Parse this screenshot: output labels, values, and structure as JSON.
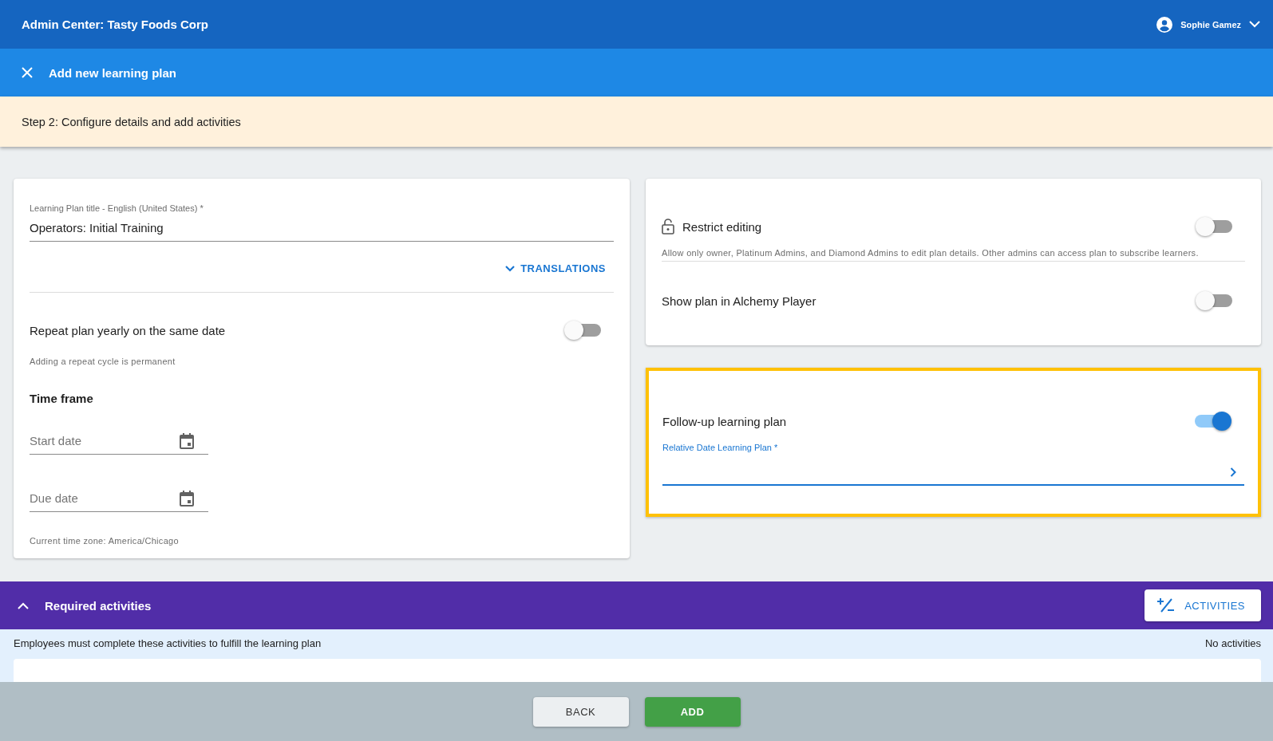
{
  "app_bar": {
    "title": "Admin Center: Tasty Foods Corp",
    "user": "Sophie Gamez"
  },
  "dialog_bar": {
    "title": "Add new learning plan"
  },
  "step_banner": {
    "text": "Step 2: Configure details and add activities"
  },
  "details_card": {
    "title_field": {
      "label": "Learning Plan title - English (United States) *",
      "value": "Operators: Initial Training"
    },
    "translations_link": {
      "label": "TRANSLATIONS",
      "expanded": false
    },
    "repeat": {
      "label": "Repeat plan yearly on the same date",
      "on": false,
      "hint": "Adding a repeat cycle is permanent"
    },
    "time_frame": {
      "heading": "Time frame",
      "dates": [
        {
          "placeholder": "Start date"
        },
        {
          "placeholder": "Due date"
        }
      ],
      "timezone": "Current time zone: America/Chicago"
    }
  },
  "settings_card": {
    "restrict": {
      "label": "Restrict editing",
      "on": false,
      "hint": "Allow only owner, Platinum Admins, and Diamond Admins to edit plan details. Other admins can access plan to subscribe learners."
    },
    "show_in_player": {
      "label": "Show plan in Alchemy Player",
      "on": false
    }
  },
  "follow_up_card": {
    "highlighted": true,
    "label": "Follow-up learning plan",
    "on": true,
    "field": {
      "label": "Relative Date Learning Plan *"
    }
  },
  "required_activities": {
    "title": "Required activities",
    "expanded": true,
    "button": "ACTIVITIES",
    "description": "Employees must complete these activities to fulfill the learning plan",
    "count": "No activities"
  },
  "footer": {
    "buttons": [
      {
        "label": "BACK",
        "kind": "secondary"
      },
      {
        "label": "ADD",
        "kind": "primary"
      }
    ]
  }
}
